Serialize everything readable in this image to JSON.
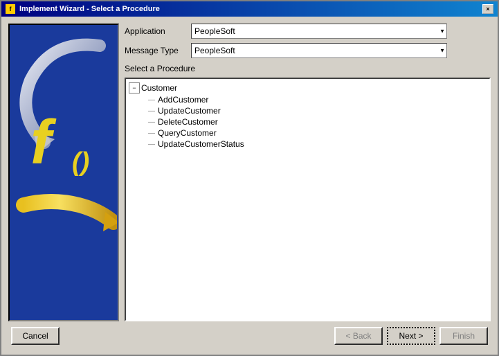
{
  "window": {
    "title": "Implement Wizard - Select a Procedure",
    "close_label": "×"
  },
  "form": {
    "application_label": "Application",
    "application_value": "PeopleSoft",
    "application_options": [
      "PeopleSoft"
    ],
    "message_type_label": "Message Type",
    "message_type_value": "PeopleSoft",
    "message_type_options": [
      "PeopleSoft"
    ],
    "section_label": "Select a Procedure"
  },
  "tree": {
    "root": {
      "label": "Customer",
      "expand_symbol": "−",
      "children": [
        {
          "label": "AddCustomer"
        },
        {
          "label": "UpdateCustomer"
        },
        {
          "label": "DeleteCustomer"
        },
        {
          "label": "QueryCustomer"
        },
        {
          "label": "UpdateCustomerStatus"
        }
      ]
    }
  },
  "buttons": {
    "cancel_label": "Cancel",
    "back_label": "< Back",
    "next_label": "Next >",
    "finish_label": "Finish"
  }
}
